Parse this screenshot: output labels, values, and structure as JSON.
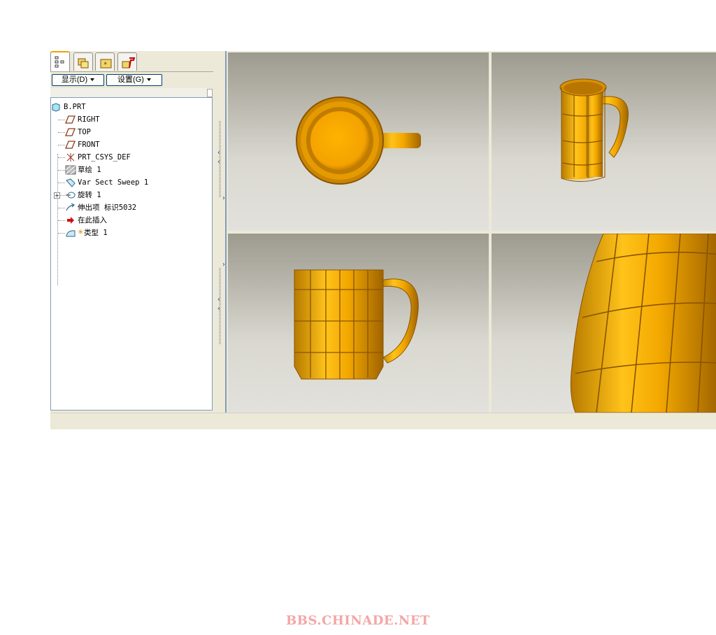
{
  "tabs": [
    {
      "name": "model-tree-tab",
      "active": true
    },
    {
      "name": "folder-tab",
      "active": false
    },
    {
      "name": "favorites-tab",
      "active": false
    },
    {
      "name": "tools-tab",
      "active": false
    }
  ],
  "toolbar": {
    "show_label": "显示(D)",
    "settings_label": "设置(G)"
  },
  "tree": {
    "root": "B.PRT",
    "items": [
      {
        "label": "RIGHT",
        "icon": "datum-plane-icon"
      },
      {
        "label": "TOP",
        "icon": "datum-plane-icon"
      },
      {
        "label": "FRONT",
        "icon": "datum-plane-icon"
      },
      {
        "label": "PRT_CSYS_DEF",
        "icon": "coordinate-system-icon"
      },
      {
        "label": "草绘 1",
        "icon": "sketch-icon"
      },
      {
        "label": "Var Sect Sweep 1",
        "icon": "sweep-icon"
      },
      {
        "label": "旋转 1",
        "icon": "revolve-icon"
      },
      {
        "label": "伸出项 标识5032",
        "icon": "protrusion-icon"
      },
      {
        "label": "在此插入",
        "icon": "insert-here-arrow-icon"
      },
      {
        "label": "类型 1",
        "icon": "surface-icon"
      }
    ]
  },
  "colors": {
    "mug": "#f2a600",
    "mug_dark": "#b97800",
    "insert_arrow": "#cc1111",
    "watermark": "#f4a6a6"
  },
  "viewports": [
    "top-view",
    "isometric-view",
    "front-view",
    "zoomed-view"
  ],
  "watermark": "BBS.CHINADE.NET"
}
